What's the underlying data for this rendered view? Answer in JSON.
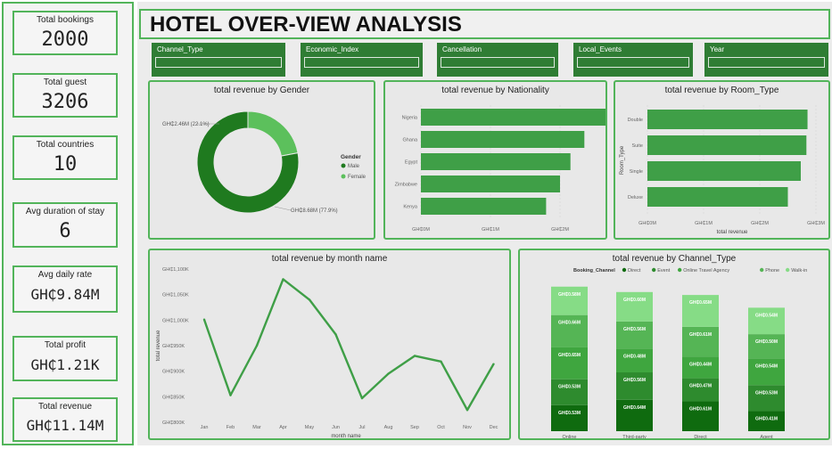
{
  "kpis": {
    "bookings": {
      "label": "Total bookings",
      "value": "2000"
    },
    "guest": {
      "label": "Total guest",
      "value": "3206"
    },
    "countries": {
      "label": "Total countries",
      "value": "10"
    },
    "stay": {
      "label": "Avg duration of stay",
      "value": "6"
    },
    "rate": {
      "label": "Avg daily rate",
      "value": "GH₵9.84M"
    },
    "profit": {
      "label": "Total profit",
      "value": "GH₵1.21K"
    },
    "revenue": {
      "label": "Total revenue",
      "value": "GH₵11.14M"
    }
  },
  "header": {
    "title": "HOTEL OVER-VIEW ANALYSIS"
  },
  "slicers": [
    "Channel_Type",
    "Economic_Index",
    "Cancellation",
    "Local_Events",
    "Year"
  ],
  "colors": {
    "dark": "#1f7a1f",
    "mid": "#3d9a3d",
    "light": "#5cc05c",
    "lighter": "#7fd67f",
    "bar": "#3f9f47",
    "slicer": "#2f7d34",
    "border": "#52b45a"
  },
  "chart_data": [
    {
      "type": "pie",
      "title": "total revenue by Gender",
      "legend_title": "Gender",
      "categories": [
        "Male",
        "Female"
      ],
      "values": [
        8.68,
        2.46
      ],
      "labels": [
        "GH₵8.68M (77.9%)",
        "GH₵2.46M (22.1%)"
      ]
    },
    {
      "type": "bar",
      "title": "total revenue by Nationality",
      "categories": [
        "Nigeria",
        "Ghana",
        "Egypt",
        "Zimbabwe",
        "Kenya"
      ],
      "values": [
        4.1,
        2.35,
        2.15,
        2.0,
        1.8
      ],
      "xticks": [
        "GH₵0M",
        "GH₵1M",
        "GH₵2M"
      ]
    },
    {
      "type": "bar",
      "title": "total revenue by Room_Type",
      "categories": [
        "Double",
        "Suite",
        "Single",
        "Deluxe"
      ],
      "values": [
        2.85,
        2.83,
        2.73,
        2.5
      ],
      "xticks": [
        "GH₵0M",
        "GH₵1M",
        "GH₵2M",
        "GH₵3M"
      ],
      "xlabel": "total revenue",
      "ylabel": "Room_Type"
    },
    {
      "type": "line",
      "title": "total revenue by month name",
      "x": [
        "Jan",
        "Feb",
        "Mar",
        "Apr",
        "May",
        "Jun",
        "Jul",
        "Aug",
        "Sep",
        "Oct",
        "Nov",
        "Dec"
      ],
      "values": [
        1001,
        853,
        950,
        1080,
        1040,
        972,
        847,
        895,
        930,
        919,
        824,
        914
      ],
      "yticks": [
        "GH₵1,100K",
        "GH₵1,050K",
        "GH₵1,000K",
        "GH₵950K",
        "GH₵900K",
        "GH₵850K",
        "GH₵800K"
      ],
      "ylim": [
        800,
        1100
      ],
      "xlabel": "month name",
      "ylabel": "total revenue"
    },
    {
      "type": "bar",
      "title": "total revenue by Channel_Type",
      "legend_title": "Booking_Channel",
      "stacked": true,
      "categories": [
        "Online",
        "Third-party",
        "Direct",
        "Agent"
      ],
      "series": [
        {
          "name": "Direct",
          "values": [
            0.53,
            0.64,
            0.61,
            0.41
          ]
        },
        {
          "name": "Event",
          "values": [
            0.53,
            0.56,
            0.47,
            0.53
          ]
        },
        {
          "name": "Online Travel Agency",
          "values": [
            0.65,
            0.48,
            0.44,
            0.54
          ]
        },
        {
          "name": "Phone",
          "values": [
            0.66,
            0.56,
            0.61,
            0.5
          ]
        },
        {
          "name": "Walk-in",
          "values": [
            0.58,
            0.6,
            0.65,
            0.54
          ]
        }
      ],
      "series_colors": [
        "#0f6b0f",
        "#2e8b2e",
        "#3fa63f",
        "#55b555",
        "#86dc86"
      ],
      "labels": [
        [
          "GH₵0.53M",
          "GH₵0.53M",
          "GH₵0.65M",
          "GH₵0.66M",
          "GH₵0.58M"
        ],
        [
          "GH₵0.64M",
          "GH₵0.56M",
          "GH₵0.48M",
          "GH₵0.56M",
          "GH₵0.60M"
        ],
        [
          "GH₵0.61M",
          "GH₵0.47M",
          "GH₵0.44M",
          "GH₵0.61M",
          "GH₵0.65M"
        ],
        [
          "GH₵0.41M",
          "GH₵0.53M",
          "GH₵0.54M",
          "GH₵0.50M",
          "GH₵0.54M"
        ]
      ]
    }
  ]
}
